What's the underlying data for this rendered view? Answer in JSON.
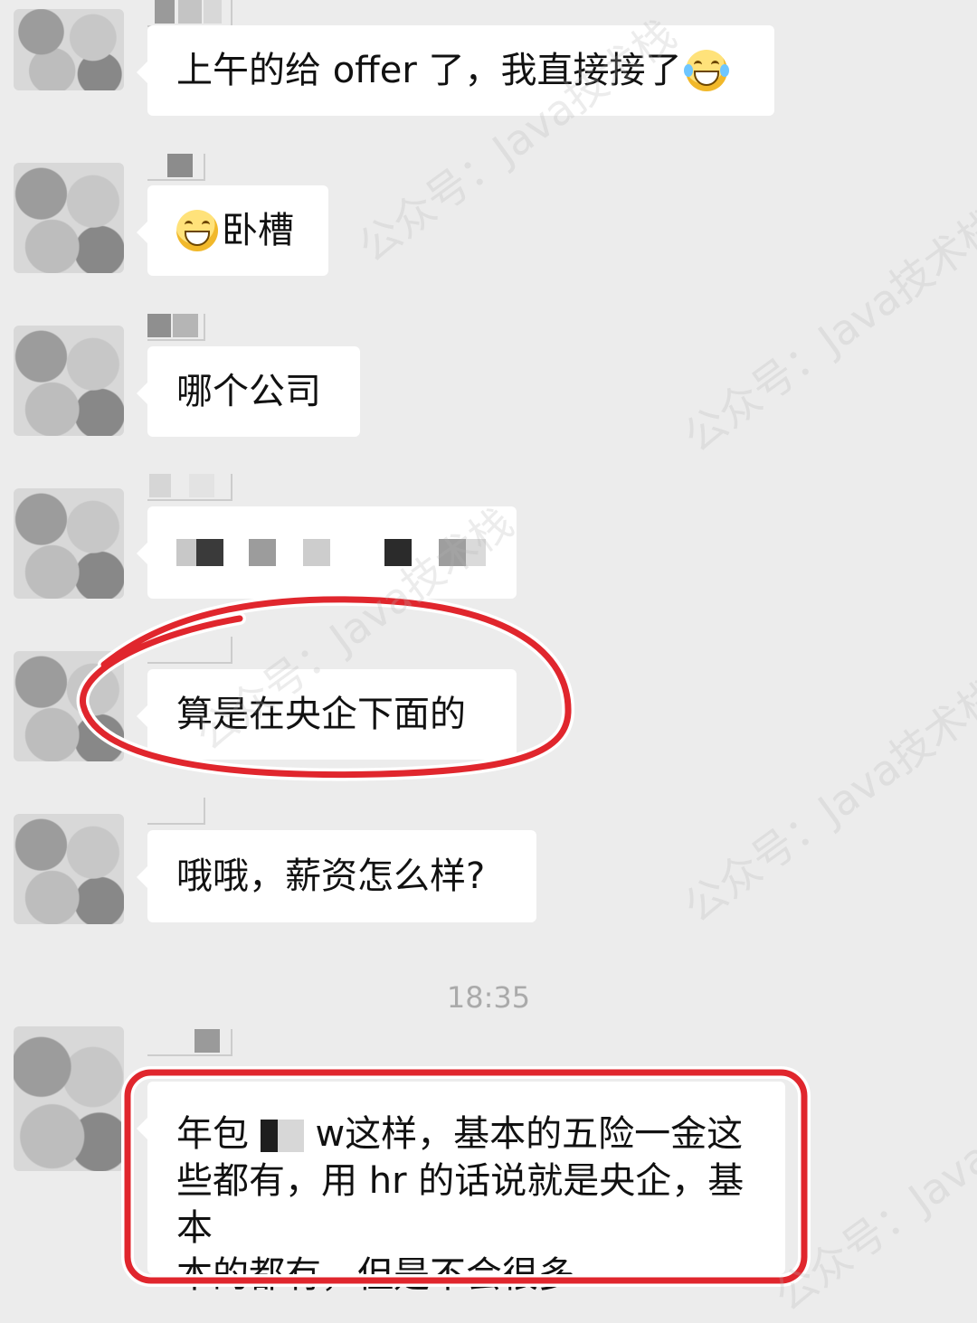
{
  "chat": {
    "messages": [
      {
        "text": "上午的给 offer 了，我直接接了",
        "emoji": "tears-of-joy-emoji"
      },
      {
        "text": "卧槽",
        "emoji_prefix": "grinning-emoji"
      },
      {
        "text": "哪个公司"
      },
      {
        "text": ""
      },
      {
        "text": "算是在央企下面的"
      },
      {
        "text": "哦哦，薪资怎么样?"
      },
      {
        "lines": [
          "年包",
          "w这样，基本的五险一金这",
          "些都有，用 hr 的话说就是央企，基本",
          "本的都有，但是不会很多"
        ]
      }
    ],
    "timestamp": "18:35"
  },
  "annotations": {
    "circle_color": "#e0262d",
    "outline_color": "#ffffff"
  },
  "watermark": {
    "text": "公众号：Java技术栈"
  }
}
